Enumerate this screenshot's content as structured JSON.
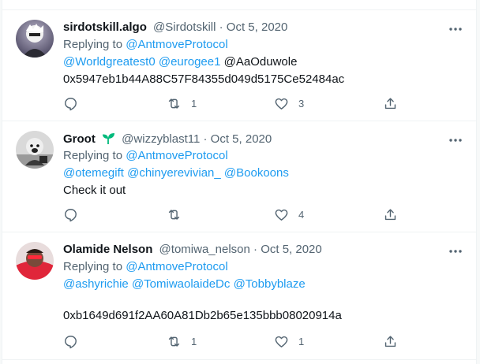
{
  "tweets": [
    {
      "display_name": "sirdotskill.algo",
      "handle": "@Sirdotskill",
      "sep": "·",
      "date": "Oct 5, 2020",
      "replying_prefix": "Replying to",
      "replying_to": "@AntmoveProtocol",
      "mentions": [
        "@Worldgreatest0",
        "@eurogee1"
      ],
      "mention_plain": "@AaOduwole",
      "body": "0x5947eb1b44A88C57F84355d049d5175Ce52484ac",
      "counts": {
        "reply": "",
        "retweet": "1",
        "like": "3"
      }
    },
    {
      "display_name": "Groot",
      "handle": "@wizzyblast11",
      "sep": "·",
      "date": "Oct 5, 2020",
      "replying_prefix": "Replying to",
      "replying_to": "@AntmoveProtocol",
      "mentions": [
        "@otemegift",
        "@chinyerevivian_",
        "@Bookoons"
      ],
      "body": "Check it out",
      "counts": {
        "reply": "",
        "retweet": "",
        "like": "4"
      }
    },
    {
      "display_name": "Olamide Nelson",
      "handle": "@tomiwa_nelson",
      "sep": "·",
      "date": "Oct 5, 2020",
      "replying_prefix": "Replying to",
      "replying_to": "@AntmoveProtocol",
      "mentions": [
        "@ashyrichie",
        "@TomiwaolaideDc",
        "@Tobbyblaze"
      ],
      "body": "0xb1649d691f2AA60A81Db2b65e135bbb08020914a",
      "counts": {
        "reply": "",
        "retweet": "1",
        "like": "1"
      }
    }
  ],
  "icons": {
    "more": "more-icon",
    "reply": "reply-icon",
    "retweet": "retweet-icon",
    "like": "like-icon",
    "share": "share-icon",
    "badge": "sprout-icon"
  },
  "colors": {
    "link": "#1d9bf0",
    "text": "#0f1419",
    "secondary": "#536471",
    "badge": "#00ba7c"
  }
}
